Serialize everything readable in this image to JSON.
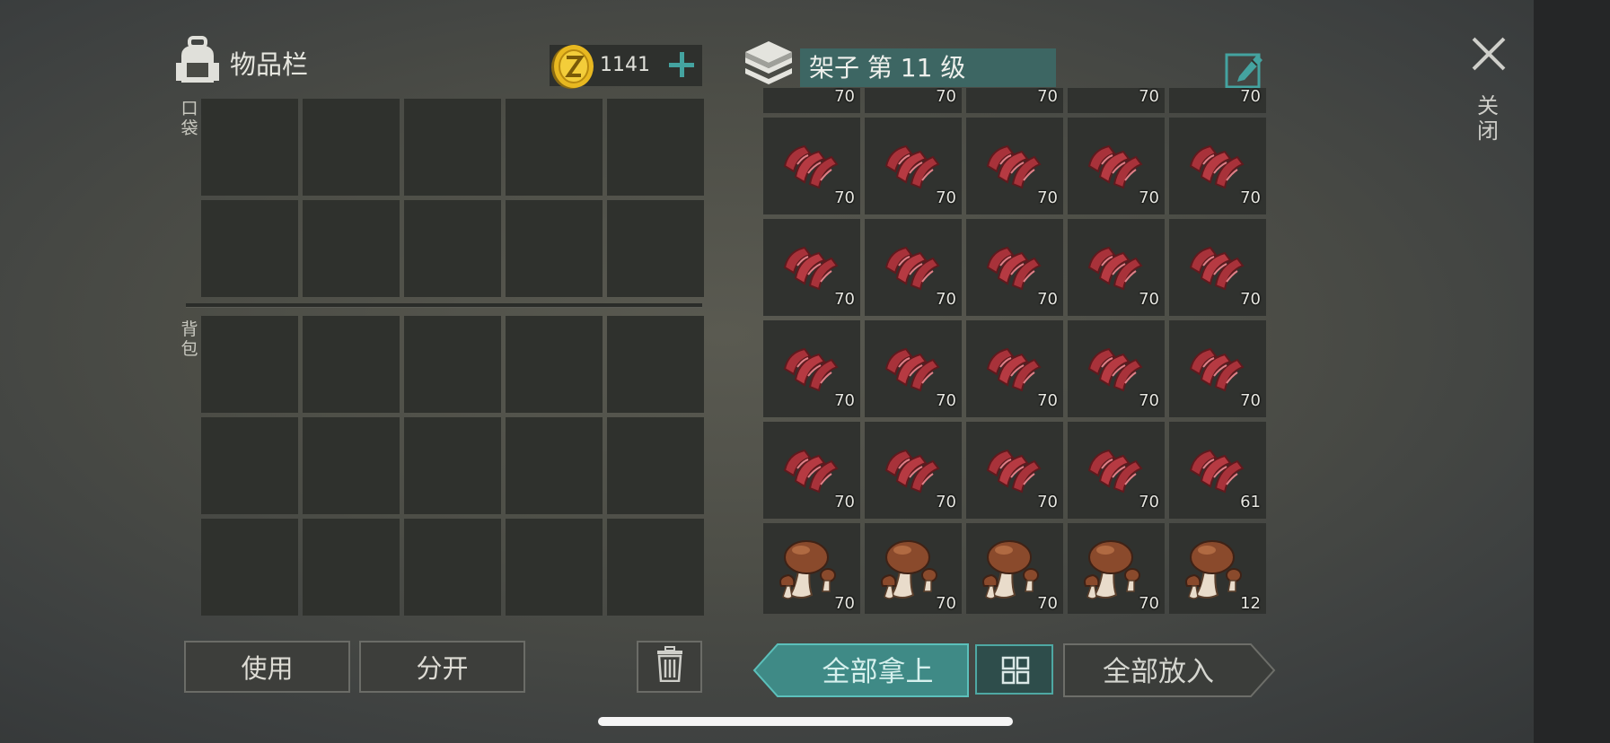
{
  "inventory": {
    "title": "物品栏",
    "pocket_label": "口袋",
    "backpack_label": "背包",
    "currency_amount": "1141"
  },
  "actions": {
    "use": "使用",
    "split": "分开"
  },
  "shelf": {
    "title": "架子 第 11 级",
    "partial_row_counts": [
      "70",
      "70",
      "70",
      "70",
      "70"
    ],
    "items": [
      {
        "icon": "meat-icon",
        "count": "70"
      },
      {
        "icon": "meat-icon",
        "count": "70"
      },
      {
        "icon": "meat-icon",
        "count": "70"
      },
      {
        "icon": "meat-icon",
        "count": "70"
      },
      {
        "icon": "meat-icon",
        "count": "70"
      },
      {
        "icon": "meat-icon",
        "count": "70"
      },
      {
        "icon": "meat-icon",
        "count": "70"
      },
      {
        "icon": "meat-icon",
        "count": "70"
      },
      {
        "icon": "meat-icon",
        "count": "70"
      },
      {
        "icon": "meat-icon",
        "count": "70"
      },
      {
        "icon": "meat-icon",
        "count": "70"
      },
      {
        "icon": "meat-icon",
        "count": "70"
      },
      {
        "icon": "meat-icon",
        "count": "70"
      },
      {
        "icon": "meat-icon",
        "count": "70"
      },
      {
        "icon": "meat-icon",
        "count": "70"
      },
      {
        "icon": "meat-icon",
        "count": "70"
      },
      {
        "icon": "meat-icon",
        "count": "70"
      },
      {
        "icon": "meat-icon",
        "count": "70"
      },
      {
        "icon": "meat-icon",
        "count": "70"
      },
      {
        "icon": "meat-icon",
        "count": "61"
      },
      {
        "icon": "mushroom-icon",
        "count": "70"
      },
      {
        "icon": "mushroom-icon",
        "count": "70"
      },
      {
        "icon": "mushroom-icon",
        "count": "70"
      },
      {
        "icon": "mushroom-icon",
        "count": "70"
      },
      {
        "icon": "mushroom-icon",
        "count": "12"
      }
    ]
  },
  "transfer": {
    "take_all": "全部拿上",
    "put_all": "全部放入"
  },
  "close_label": "关闭",
  "colors": {
    "accent": "#44a3a0",
    "slot": "#2f312d",
    "title_bar": "#3d6663"
  }
}
